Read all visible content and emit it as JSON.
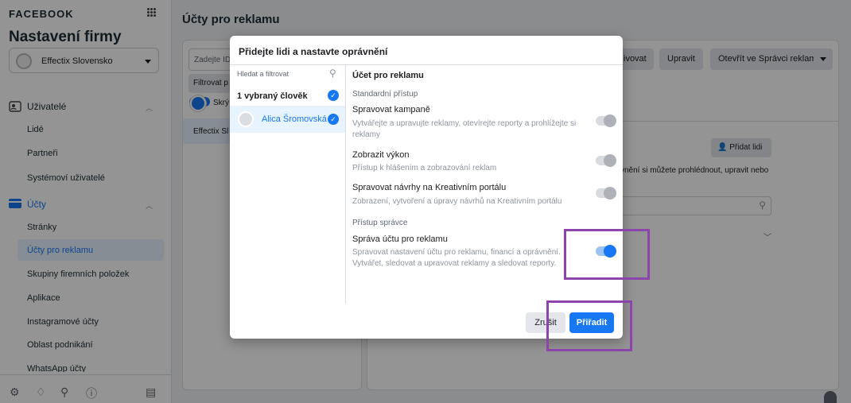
{
  "sidebar": {
    "brand": "FACEBOOK",
    "title": "Nastavení firmy",
    "business_select": "Effectix Slovensko",
    "sections": [
      {
        "label": "Uživatelé",
        "items": [
          "Lidé",
          "Partneři",
          "Systémoví uživatelé"
        ]
      },
      {
        "label": "Účty",
        "items": [
          "Stránky",
          "Účty pro reklamu",
          "Skupiny firemních položek",
          "Aplikace",
          "Instagramové účty",
          "Oblast podnikání",
          "WhatsApp účty"
        ]
      }
    ],
    "active_item": "Účty pro reklamu"
  },
  "main": {
    "title": "Účty pro reklamu",
    "filter_placeholder": "Zadejte ID",
    "filter_button": "Filtrovat p",
    "toggle_label": "Skrý",
    "account_row": "Effectix Sl",
    "top_buttons": [
      "ivovat",
      "Upravit",
      "Otevřít ve Správci reklam"
    ],
    "add_people": "Přidat lidi",
    "perm_text": "vnění si můžete prohlédnout, upravit nebo"
  },
  "modal": {
    "title": "Přidejte lidi a nastavte oprávnění",
    "search_placeholder": "Hledat a filtrovat",
    "selected_count": "1 vybraný člověk",
    "person": "Alica Šromovská",
    "right_title": "Účet pro reklamu",
    "group_standard": "Standardní přístup",
    "group_admin": "Přístup správce",
    "permissions": [
      {
        "name": "Spravovat kampaně",
        "desc": "Vytvářejte a upravujte reklamy, otevírejte reporty a prohlížejte si reklamy",
        "enabled": false
      },
      {
        "name": "Zobrazit výkon",
        "desc": "Přístup k hlášením a zobrazování reklam",
        "enabled": false
      },
      {
        "name": "Spravovat návrhy na Kreativním portálu",
        "desc": "Zobrazení, vytvoření a úpravy návrhů na Kreativním portálu",
        "enabled": false
      },
      {
        "name": "Správa účtu pro reklamu",
        "desc": "Spravovat nastavení účtu pro reklamu, financí a oprávnění. Vytvářet, sledovat a upravovat reklamy a sledovat reporty.",
        "enabled": true
      }
    ],
    "cancel": "Zrušit",
    "assign": "Přiřadit"
  },
  "colors": {
    "accent": "#1877f2",
    "highlight": "#8e44ad"
  }
}
